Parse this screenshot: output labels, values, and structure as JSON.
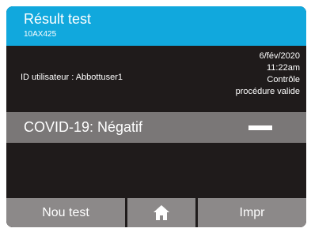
{
  "header": {
    "title": "Résult test",
    "test_id": "10AX425",
    "color": "#11a8dd"
  },
  "info": {
    "user_id": "ID utilisateur : Abbottuser1",
    "date": "6/fév/2020",
    "time": "11:22am",
    "control_line1": "Contrôle",
    "control_line2": "procédure valide"
  },
  "result": {
    "label": "COVID-19: Négatif",
    "indicator": "negative-dash"
  },
  "footer": {
    "new_test_label": "Nou test",
    "home_icon": "home-icon",
    "print_label": "Impr"
  }
}
